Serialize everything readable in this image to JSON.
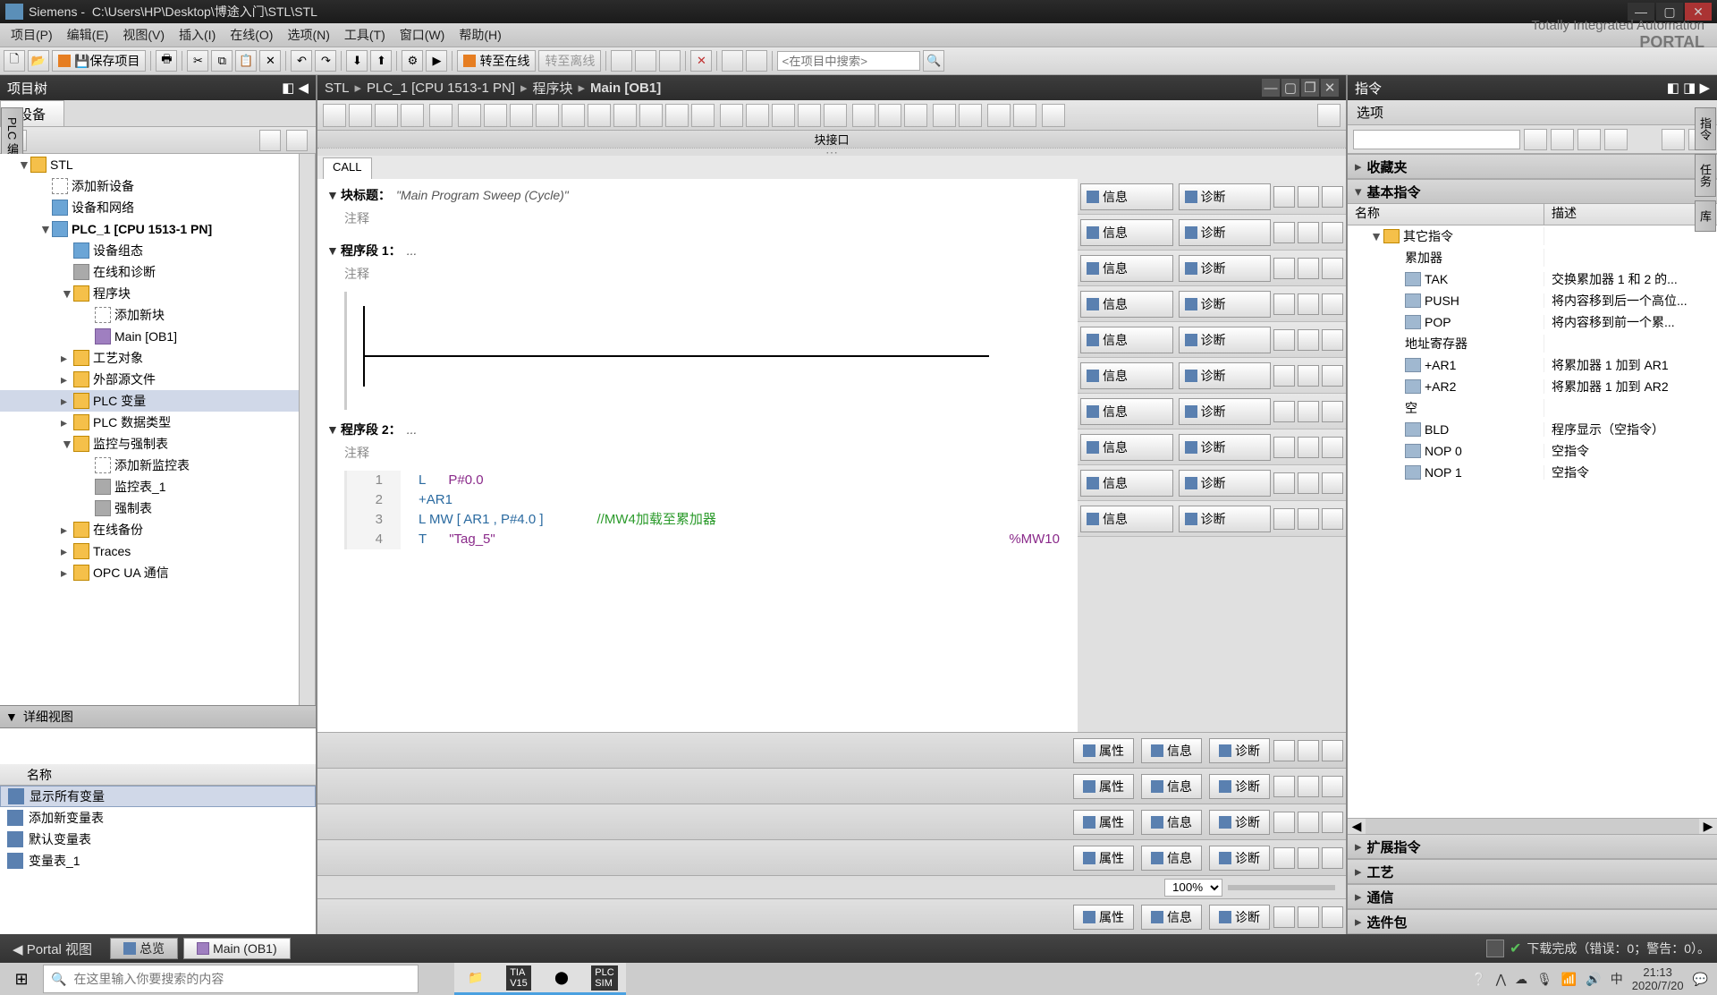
{
  "window": {
    "app": "Siemens",
    "path": "C:\\Users\\HP\\Desktop\\博途入门\\STL\\STL"
  },
  "menu": {
    "items": [
      "项目(P)",
      "编辑(E)",
      "视图(V)",
      "插入(I)",
      "在线(O)",
      "选项(N)",
      "工具(T)",
      "窗口(W)",
      "帮助(H)"
    ],
    "brand_line1": "Totally Integrated Automation",
    "brand_line2": "PORTAL"
  },
  "toolbar": {
    "save": "保存项目",
    "go_online": "转至在线",
    "go_offline": "转至离线",
    "search_placeholder": "<在项目中搜索>"
  },
  "left_panel": {
    "title": "项目树",
    "tab": "设备",
    "tree": {
      "root": "STL",
      "add_device": "添加新设备",
      "devices_net": "设备和网络",
      "plc": "PLC_1 [CPU 1513-1 PN]",
      "device_cfg": "设备组态",
      "online_diag": "在线和诊断",
      "blocks": "程序块",
      "add_block": "添加新块",
      "main_ob": "Main [OB1]",
      "tech_obj": "工艺对象",
      "ext_src": "外部源文件",
      "plc_var": "PLC 变量",
      "plc_dt": "PLC 数据类型",
      "watch": "监控与强制表",
      "add_watch": "添加新监控表",
      "watch1": "监控表_1",
      "force": "强制表",
      "online_bak": "在线备份",
      "traces": "Traces",
      "opcua": "OPC UA 通信"
    },
    "detail": {
      "title": "详细视图",
      "col_name": "名称",
      "rows": [
        "显示所有变量",
        "添加新变量表",
        "默认变量表",
        "变量表_1"
      ]
    }
  },
  "editor": {
    "breadcrumb": [
      "STL",
      "PLC_1 [CPU 1513-1 PN]",
      "程序块",
      "Main [OB1]"
    ],
    "interface_label": "块接口",
    "call_tab": "CALL",
    "block_title_label": "块标题：",
    "block_title_value": "\"Main Program Sweep (Cycle)\"",
    "comment_label": "注释",
    "network1": {
      "label": "程序段 1：",
      "desc": "..."
    },
    "network2": {
      "label": "程序段 2：",
      "desc": "...",
      "lines": [
        {
          "n": "1",
          "op": "L",
          "arg": "P#0.0"
        },
        {
          "n": "2",
          "op": "+AR1",
          "arg": ""
        },
        {
          "n": "3",
          "op": "L MW [ AR1 , P#4.0 ]",
          "arg": "",
          "cmt": "//MW4加载至累加器"
        },
        {
          "n": "4",
          "op": "T",
          "arg": "\"Tag_5\"",
          "addr": "%MW10"
        }
      ]
    },
    "diag": {
      "info": "信息",
      "diag": "诊断",
      "prop": "属性"
    },
    "zoom": "100%"
  },
  "right_panel": {
    "title": "指令",
    "options": "选项",
    "fav": "收藏夹",
    "basic": "基本指令",
    "col_name": "名称",
    "col_desc": "描述",
    "other_inst": "其它指令",
    "rows": [
      {
        "name": "累加器",
        "desc": "",
        "folder": true
      },
      {
        "name": "TAK",
        "desc": "交换累加器 1 和 2 的..."
      },
      {
        "name": "PUSH",
        "desc": "将内容移到后一个高位..."
      },
      {
        "name": "POP",
        "desc": "将内容移到前一个累..."
      },
      {
        "name": "地址寄存器",
        "desc": "",
        "folder": true
      },
      {
        "name": "+AR1",
        "desc": "将累加器 1 加到 AR1"
      },
      {
        "name": "+AR2",
        "desc": "将累加器 1 加到 AR2"
      },
      {
        "name": "空",
        "desc": "",
        "folder": true
      },
      {
        "name": "BLD",
        "desc": "程序显示（空指令）"
      },
      {
        "name": "NOP 0",
        "desc": "空指令"
      },
      {
        "name": "NOP 1",
        "desc": "空指令"
      }
    ],
    "ext": "扩展指令",
    "tech": "工艺",
    "comm": "通信",
    "opt_pkg": "选件包"
  },
  "status": {
    "portal": "Portal 视图",
    "overview": "总览",
    "main": "Main (OB1)",
    "msg": "下载完成（错误：0；警告：0）。"
  },
  "taskbar": {
    "search_placeholder": "在这里输入你要搜索的内容",
    "time": "21:13",
    "date": "2020/7/20"
  },
  "side_tabs": {
    "left": "PLC 编程",
    "right": [
      "指令",
      "任务",
      "库"
    ]
  }
}
